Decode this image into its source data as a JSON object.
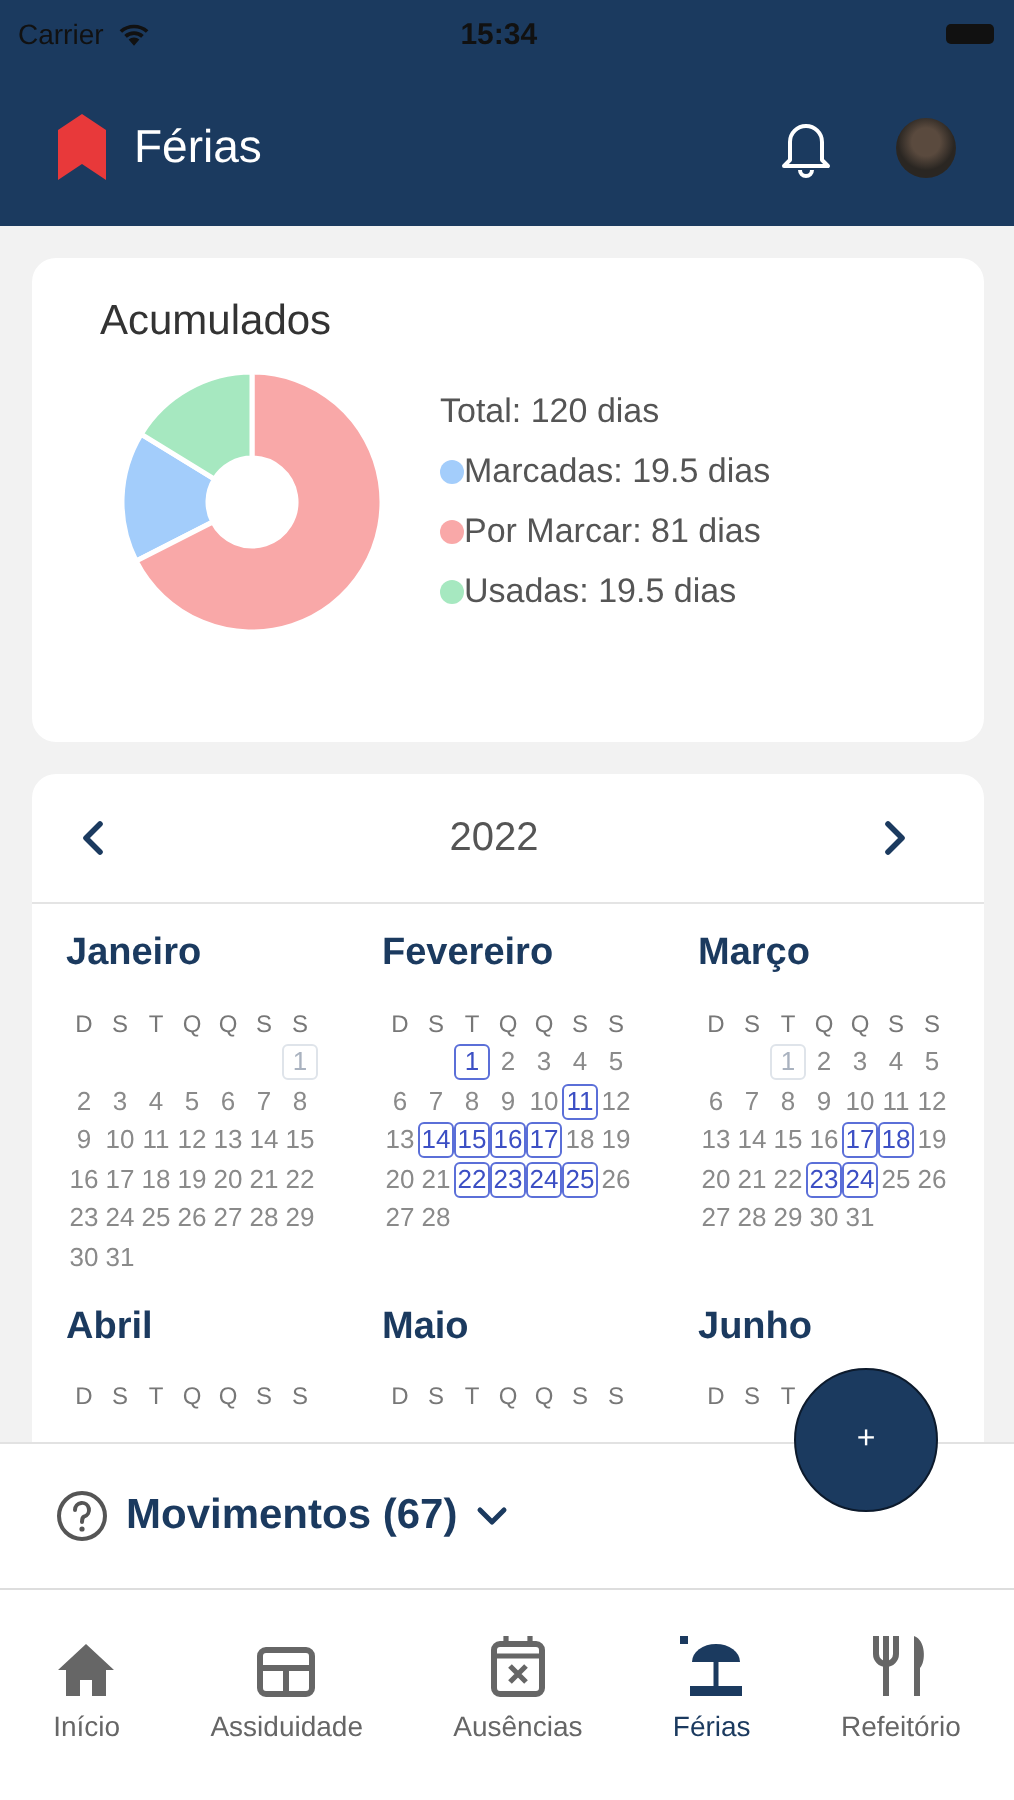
{
  "status_bar": {
    "carrier": "Carrier",
    "time": "15:34"
  },
  "header": {
    "title": "Férias"
  },
  "summary": {
    "title": "Acumulados",
    "total": "Total: 120 dias",
    "legend": [
      {
        "color": "#a3cdfb"
      },
      {
        "color": "#f9a8a8"
      },
      {
        "color": "#a6e8c0"
      }
    ],
    "chart_data": {
      "type": "donut",
      "categories": [
        "Marcadas: 19.5 dias",
        "Por Marcar: 81 dias",
        "Usadas: 19.5 dias"
      ],
      "values": [
        19.5,
        81,
        19.5
      ]
    }
  },
  "calendar": {
    "year": "2022",
    "months": [
      {
        "name": "Janeiro",
        "weekdays": [
          "D",
          "S",
          "T",
          "Q",
          "Q",
          "S",
          "S"
        ],
        "weeks": [
          [
            {
              "d": "1",
              "kind": "holiday"
            }
          ],
          [
            {
              "d": "2",
              "kind": "plain"
            },
            {
              "d": "3",
              "kind": "plain"
            },
            {
              "d": "4",
              "kind": "plain"
            },
            {
              "d": "5",
              "kind": "plain"
            },
            {
              "d": "6",
              "kind": "plain"
            },
            {
              "d": "7",
              "kind": "plain"
            },
            {
              "d": "8",
              "kind": "plain"
            }
          ],
          [
            {
              "d": "9",
              "kind": "plain"
            },
            {
              "d": "10",
              "kind": "plain"
            },
            {
              "d": "11",
              "kind": "plain"
            },
            {
              "d": "12",
              "kind": "plain"
            },
            {
              "d": "13",
              "kind": "plain"
            },
            {
              "d": "14",
              "kind": "plain"
            },
            {
              "d": "15",
              "kind": "plain"
            }
          ],
          [
            {
              "d": "16",
              "kind": "plain"
            },
            {
              "d": "17",
              "kind": "plain"
            },
            {
              "d": "18",
              "kind": "plain"
            },
            {
              "d": "19",
              "kind": "plain"
            },
            {
              "d": "20",
              "kind": "plain"
            },
            {
              "d": "21",
              "kind": "plain"
            },
            {
              "d": "22",
              "kind": "plain"
            }
          ],
          [
            {
              "d": "23",
              "kind": "plain"
            },
            {
              "d": "24",
              "kind": "plain"
            },
            {
              "d": "25",
              "kind": "plain"
            },
            {
              "d": "26",
              "kind": "plain"
            },
            {
              "d": "27",
              "kind": "plain"
            },
            {
              "d": "28",
              "kind": "plain"
            },
            {
              "d": "29",
              "kind": "plain"
            }
          ],
          [
            {
              "d": "30",
              "kind": "plain"
            },
            {
              "d": "31",
              "kind": "plain"
            }
          ]
        ]
      },
      {
        "name": "Fevereiro",
        "weekdays": [
          "D",
          "S",
          "T",
          "Q",
          "Q",
          "S",
          "S"
        ],
        "weeks": [
          [
            {
              "d": "1",
              "kind": "marked"
            },
            {
              "d": "2",
              "kind": "plain"
            },
            {
              "d": "3",
              "kind": "plain"
            },
            {
              "d": "4",
              "kind": "plain"
            },
            {
              "d": "5",
              "kind": "plain"
            }
          ],
          [
            {
              "d": "6",
              "kind": "plain"
            },
            {
              "d": "7",
              "kind": "plain"
            },
            {
              "d": "8",
              "kind": "plain"
            },
            {
              "d": "9",
              "kind": "plain"
            },
            {
              "d": "10",
              "kind": "plain"
            },
            {
              "d": "11",
              "kind": "marked"
            },
            {
              "d": "12",
              "kind": "plain"
            }
          ],
          [
            {
              "d": "13",
              "kind": "plain"
            },
            {
              "d": "14",
              "kind": "marked"
            },
            {
              "d": "15",
              "kind": "marked"
            },
            {
              "d": "16",
              "kind": "marked"
            },
            {
              "d": "17",
              "kind": "marked"
            },
            {
              "d": "18",
              "kind": "plain"
            },
            {
              "d": "19",
              "kind": "plain"
            }
          ],
          [
            {
              "d": "20",
              "kind": "plain"
            },
            {
              "d": "21",
              "kind": "plain"
            },
            {
              "d": "22",
              "kind": "marked"
            },
            {
              "d": "23",
              "kind": "marked"
            },
            {
              "d": "24",
              "kind": "marked"
            },
            {
              "d": "25",
              "kind": "marked"
            },
            {
              "d": "26",
              "kind": "plain"
            }
          ],
          [
            {
              "d": "27",
              "kind": "plain"
            },
            {
              "d": "28",
              "kind": "plain"
            }
          ]
        ]
      },
      {
        "name": "Março",
        "weekdays": [
          "D",
          "S",
          "T",
          "Q",
          "Q",
          "S",
          "S"
        ],
        "weeks": [
          [
            {
              "d": "1",
              "kind": "holiday"
            },
            {
              "d": "2",
              "kind": "plain"
            },
            {
              "d": "3",
              "kind": "plain"
            },
            {
              "d": "4",
              "kind": "plain"
            },
            {
              "d": "5",
              "kind": "plain"
            }
          ],
          [
            {
              "d": "6",
              "kind": "plain"
            },
            {
              "d": "7",
              "kind": "plain"
            },
            {
              "d": "8",
              "kind": "plain"
            },
            {
              "d": "9",
              "kind": "plain"
            },
            {
              "d": "10",
              "kind": "plain"
            },
            {
              "d": "11",
              "kind": "plain"
            },
            {
              "d": "12",
              "kind": "plain"
            }
          ],
          [
            {
              "d": "13",
              "kind": "plain"
            },
            {
              "d": "14",
              "kind": "plain"
            },
            {
              "d": "15",
              "kind": "plain"
            },
            {
              "d": "16",
              "kind": "plain"
            },
            {
              "d": "17",
              "kind": "marked"
            },
            {
              "d": "18",
              "kind": "marked"
            },
            {
              "d": "19",
              "kind": "plain"
            }
          ],
          [
            {
              "d": "20",
              "kind": "plain"
            },
            {
              "d": "21",
              "kind": "plain"
            },
            {
              "d": "22",
              "kind": "plain"
            },
            {
              "d": "23",
              "kind": "marked"
            },
            {
              "d": "24",
              "kind": "marked"
            },
            {
              "d": "25",
              "kind": "plain"
            },
            {
              "d": "26",
              "kind": "plain"
            }
          ],
          [
            {
              "d": "27",
              "kind": "plain"
            },
            {
              "d": "28",
              "kind": "plain"
            },
            {
              "d": "29",
              "kind": "plain"
            },
            {
              "d": "30",
              "kind": "plain"
            },
            {
              "d": "31",
              "kind": "plain"
            }
          ]
        ]
      },
      {
        "name": "Abril",
        "weekdays": [
          "D",
          "S",
          "T",
          "Q",
          "Q",
          "S",
          "S"
        ]
      },
      {
        "name": "Maio",
        "weekdays": [
          "D",
          "S",
          "T",
          "Q",
          "Q",
          "S",
          "S"
        ]
      },
      {
        "name": "Junho",
        "weekdays": [
          "D",
          "S",
          "T"
        ]
      }
    ]
  },
  "movements": {
    "title": "Movimentos (67)",
    "expanded": false
  },
  "fab": {
    "label": "+"
  },
  "tab_bar": [
    {
      "label": "Início",
      "kind": "home",
      "selected": false
    },
    {
      "label": "Assiduidade",
      "kind": "grid",
      "selected": false
    },
    {
      "label": "Ausências",
      "kind": "calendar",
      "selected": false
    },
    {
      "label": "Férias",
      "kind": "beach",
      "selected": true
    },
    {
      "label": "Refeitório",
      "kind": "cutlery",
      "selected": false
    }
  ]
}
